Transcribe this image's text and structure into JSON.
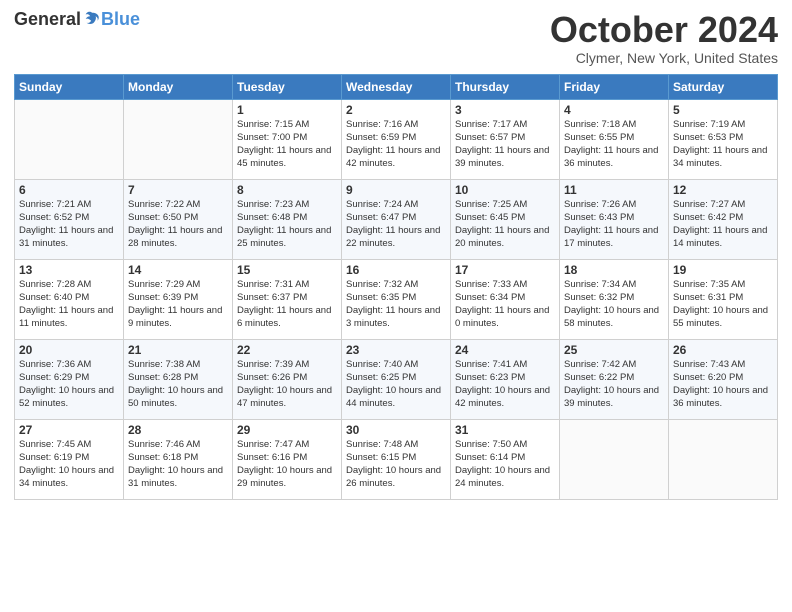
{
  "header": {
    "logo_general": "General",
    "logo_blue": "Blue",
    "title": "October 2024",
    "location": "Clymer, New York, United States"
  },
  "weekdays": [
    "Sunday",
    "Monday",
    "Tuesday",
    "Wednesday",
    "Thursday",
    "Friday",
    "Saturday"
  ],
  "weeks": [
    [
      {
        "day": "",
        "sunrise": "",
        "sunset": "",
        "daylight": ""
      },
      {
        "day": "",
        "sunrise": "",
        "sunset": "",
        "daylight": ""
      },
      {
        "day": "1",
        "sunrise": "Sunrise: 7:15 AM",
        "sunset": "Sunset: 7:00 PM",
        "daylight": "Daylight: 11 hours and 45 minutes."
      },
      {
        "day": "2",
        "sunrise": "Sunrise: 7:16 AM",
        "sunset": "Sunset: 6:59 PM",
        "daylight": "Daylight: 11 hours and 42 minutes."
      },
      {
        "day": "3",
        "sunrise": "Sunrise: 7:17 AM",
        "sunset": "Sunset: 6:57 PM",
        "daylight": "Daylight: 11 hours and 39 minutes."
      },
      {
        "day": "4",
        "sunrise": "Sunrise: 7:18 AM",
        "sunset": "Sunset: 6:55 PM",
        "daylight": "Daylight: 11 hours and 36 minutes."
      },
      {
        "day": "5",
        "sunrise": "Sunrise: 7:19 AM",
        "sunset": "Sunset: 6:53 PM",
        "daylight": "Daylight: 11 hours and 34 minutes."
      }
    ],
    [
      {
        "day": "6",
        "sunrise": "Sunrise: 7:21 AM",
        "sunset": "Sunset: 6:52 PM",
        "daylight": "Daylight: 11 hours and 31 minutes."
      },
      {
        "day": "7",
        "sunrise": "Sunrise: 7:22 AM",
        "sunset": "Sunset: 6:50 PM",
        "daylight": "Daylight: 11 hours and 28 minutes."
      },
      {
        "day": "8",
        "sunrise": "Sunrise: 7:23 AM",
        "sunset": "Sunset: 6:48 PM",
        "daylight": "Daylight: 11 hours and 25 minutes."
      },
      {
        "day": "9",
        "sunrise": "Sunrise: 7:24 AM",
        "sunset": "Sunset: 6:47 PM",
        "daylight": "Daylight: 11 hours and 22 minutes."
      },
      {
        "day": "10",
        "sunrise": "Sunrise: 7:25 AM",
        "sunset": "Sunset: 6:45 PM",
        "daylight": "Daylight: 11 hours and 20 minutes."
      },
      {
        "day": "11",
        "sunrise": "Sunrise: 7:26 AM",
        "sunset": "Sunset: 6:43 PM",
        "daylight": "Daylight: 11 hours and 17 minutes."
      },
      {
        "day": "12",
        "sunrise": "Sunrise: 7:27 AM",
        "sunset": "Sunset: 6:42 PM",
        "daylight": "Daylight: 11 hours and 14 minutes."
      }
    ],
    [
      {
        "day": "13",
        "sunrise": "Sunrise: 7:28 AM",
        "sunset": "Sunset: 6:40 PM",
        "daylight": "Daylight: 11 hours and 11 minutes."
      },
      {
        "day": "14",
        "sunrise": "Sunrise: 7:29 AM",
        "sunset": "Sunset: 6:39 PM",
        "daylight": "Daylight: 11 hours and 9 minutes."
      },
      {
        "day": "15",
        "sunrise": "Sunrise: 7:31 AM",
        "sunset": "Sunset: 6:37 PM",
        "daylight": "Daylight: 11 hours and 6 minutes."
      },
      {
        "day": "16",
        "sunrise": "Sunrise: 7:32 AM",
        "sunset": "Sunset: 6:35 PM",
        "daylight": "Daylight: 11 hours and 3 minutes."
      },
      {
        "day": "17",
        "sunrise": "Sunrise: 7:33 AM",
        "sunset": "Sunset: 6:34 PM",
        "daylight": "Daylight: 11 hours and 0 minutes."
      },
      {
        "day": "18",
        "sunrise": "Sunrise: 7:34 AM",
        "sunset": "Sunset: 6:32 PM",
        "daylight": "Daylight: 10 hours and 58 minutes."
      },
      {
        "day": "19",
        "sunrise": "Sunrise: 7:35 AM",
        "sunset": "Sunset: 6:31 PM",
        "daylight": "Daylight: 10 hours and 55 minutes."
      }
    ],
    [
      {
        "day": "20",
        "sunrise": "Sunrise: 7:36 AM",
        "sunset": "Sunset: 6:29 PM",
        "daylight": "Daylight: 10 hours and 52 minutes."
      },
      {
        "day": "21",
        "sunrise": "Sunrise: 7:38 AM",
        "sunset": "Sunset: 6:28 PM",
        "daylight": "Daylight: 10 hours and 50 minutes."
      },
      {
        "day": "22",
        "sunrise": "Sunrise: 7:39 AM",
        "sunset": "Sunset: 6:26 PM",
        "daylight": "Daylight: 10 hours and 47 minutes."
      },
      {
        "day": "23",
        "sunrise": "Sunrise: 7:40 AM",
        "sunset": "Sunset: 6:25 PM",
        "daylight": "Daylight: 10 hours and 44 minutes."
      },
      {
        "day": "24",
        "sunrise": "Sunrise: 7:41 AM",
        "sunset": "Sunset: 6:23 PM",
        "daylight": "Daylight: 10 hours and 42 minutes."
      },
      {
        "day": "25",
        "sunrise": "Sunrise: 7:42 AM",
        "sunset": "Sunset: 6:22 PM",
        "daylight": "Daylight: 10 hours and 39 minutes."
      },
      {
        "day": "26",
        "sunrise": "Sunrise: 7:43 AM",
        "sunset": "Sunset: 6:20 PM",
        "daylight": "Daylight: 10 hours and 36 minutes."
      }
    ],
    [
      {
        "day": "27",
        "sunrise": "Sunrise: 7:45 AM",
        "sunset": "Sunset: 6:19 PM",
        "daylight": "Daylight: 10 hours and 34 minutes."
      },
      {
        "day": "28",
        "sunrise": "Sunrise: 7:46 AM",
        "sunset": "Sunset: 6:18 PM",
        "daylight": "Daylight: 10 hours and 31 minutes."
      },
      {
        "day": "29",
        "sunrise": "Sunrise: 7:47 AM",
        "sunset": "Sunset: 6:16 PM",
        "daylight": "Daylight: 10 hours and 29 minutes."
      },
      {
        "day": "30",
        "sunrise": "Sunrise: 7:48 AM",
        "sunset": "Sunset: 6:15 PM",
        "daylight": "Daylight: 10 hours and 26 minutes."
      },
      {
        "day": "31",
        "sunrise": "Sunrise: 7:50 AM",
        "sunset": "Sunset: 6:14 PM",
        "daylight": "Daylight: 10 hours and 24 minutes."
      },
      {
        "day": "",
        "sunrise": "",
        "sunset": "",
        "daylight": ""
      },
      {
        "day": "",
        "sunrise": "",
        "sunset": "",
        "daylight": ""
      }
    ]
  ]
}
